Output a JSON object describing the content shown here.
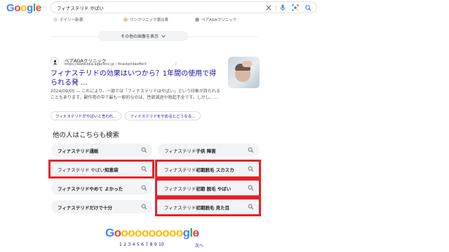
{
  "colors": {
    "google_blue": "#4285F4",
    "google_red": "#EA4335",
    "google_yellow": "#FBBC05",
    "google_green": "#34A853",
    "link": "#1a0dab",
    "highlight_border": "#e8202a"
  },
  "header": {
    "logo": [
      "G",
      "o",
      "o",
      "g",
      "l",
      "e"
    ],
    "search_query": "フィナステリド やばい",
    "icons": [
      "close-icon",
      "mic-icon",
      "lens-icon",
      "search-icon"
    ]
  },
  "image_sources": [
    {
      "label": "デイリー新潮"
    },
    {
      "label": "ワンクリニック恵比寿"
    },
    {
      "label": "ベアAGAクリニック"
    }
  ],
  "more_images": {
    "label": "その他の画像を表示"
  },
  "result": {
    "site_name": "ベアAGAクリニック",
    "url": "https://www.bea-agaclinic.jp › finasteridaeffect",
    "title": "フィナステリドの効果はいつから？1年間の使用で得られる発 ...",
    "snippet": "2024/09/05 — これにより、一部では「フィナステリドはやばい」という印象が持たれることもあります。副作用の中で最も一般的なのは、性欲減退や勃起不全です。しかし、...",
    "chips": [
      "フィナステリドがやばいと言われ...",
      "フィナステリドをやめるとどうなる..."
    ]
  },
  "people_also_search": {
    "heading": "他の人はこちらも検索",
    "items": [
      {
        "plain": "フィナステリド",
        "bold": "通販",
        "highlighted": false
      },
      {
        "plain": "フィナステリド ",
        "bold": "子供 障害",
        "highlighted": false
      },
      {
        "plain": "フィナステリド やばい ",
        "bold": "知恵袋",
        "highlighted": true
      },
      {
        "plain": "フィナステリド ",
        "bold": "初期脱毛 スカスカ",
        "highlighted": true
      },
      {
        "plain": "フィナステリド",
        "bold": "やめて よかった",
        "highlighted": false
      },
      {
        "plain": "フィナステリド ",
        "bold": "初期 脱毛 やばい",
        "highlighted": true
      },
      {
        "plain": "フィナステリド",
        "bold": "だけで十分",
        "highlighted": false
      },
      {
        "plain": "フィナステリド ",
        "bold": "初期脱毛 見た目",
        "highlighted": true
      }
    ]
  },
  "pagination": {
    "logo_start": "G",
    "logo_o": "oooooooooo",
    "logo_end": "gle",
    "pages": [
      "1",
      "2",
      "3",
      "4",
      "5",
      "6",
      "7",
      "8",
      "9",
      "10"
    ],
    "current": "1",
    "next_label": "次へ"
  }
}
